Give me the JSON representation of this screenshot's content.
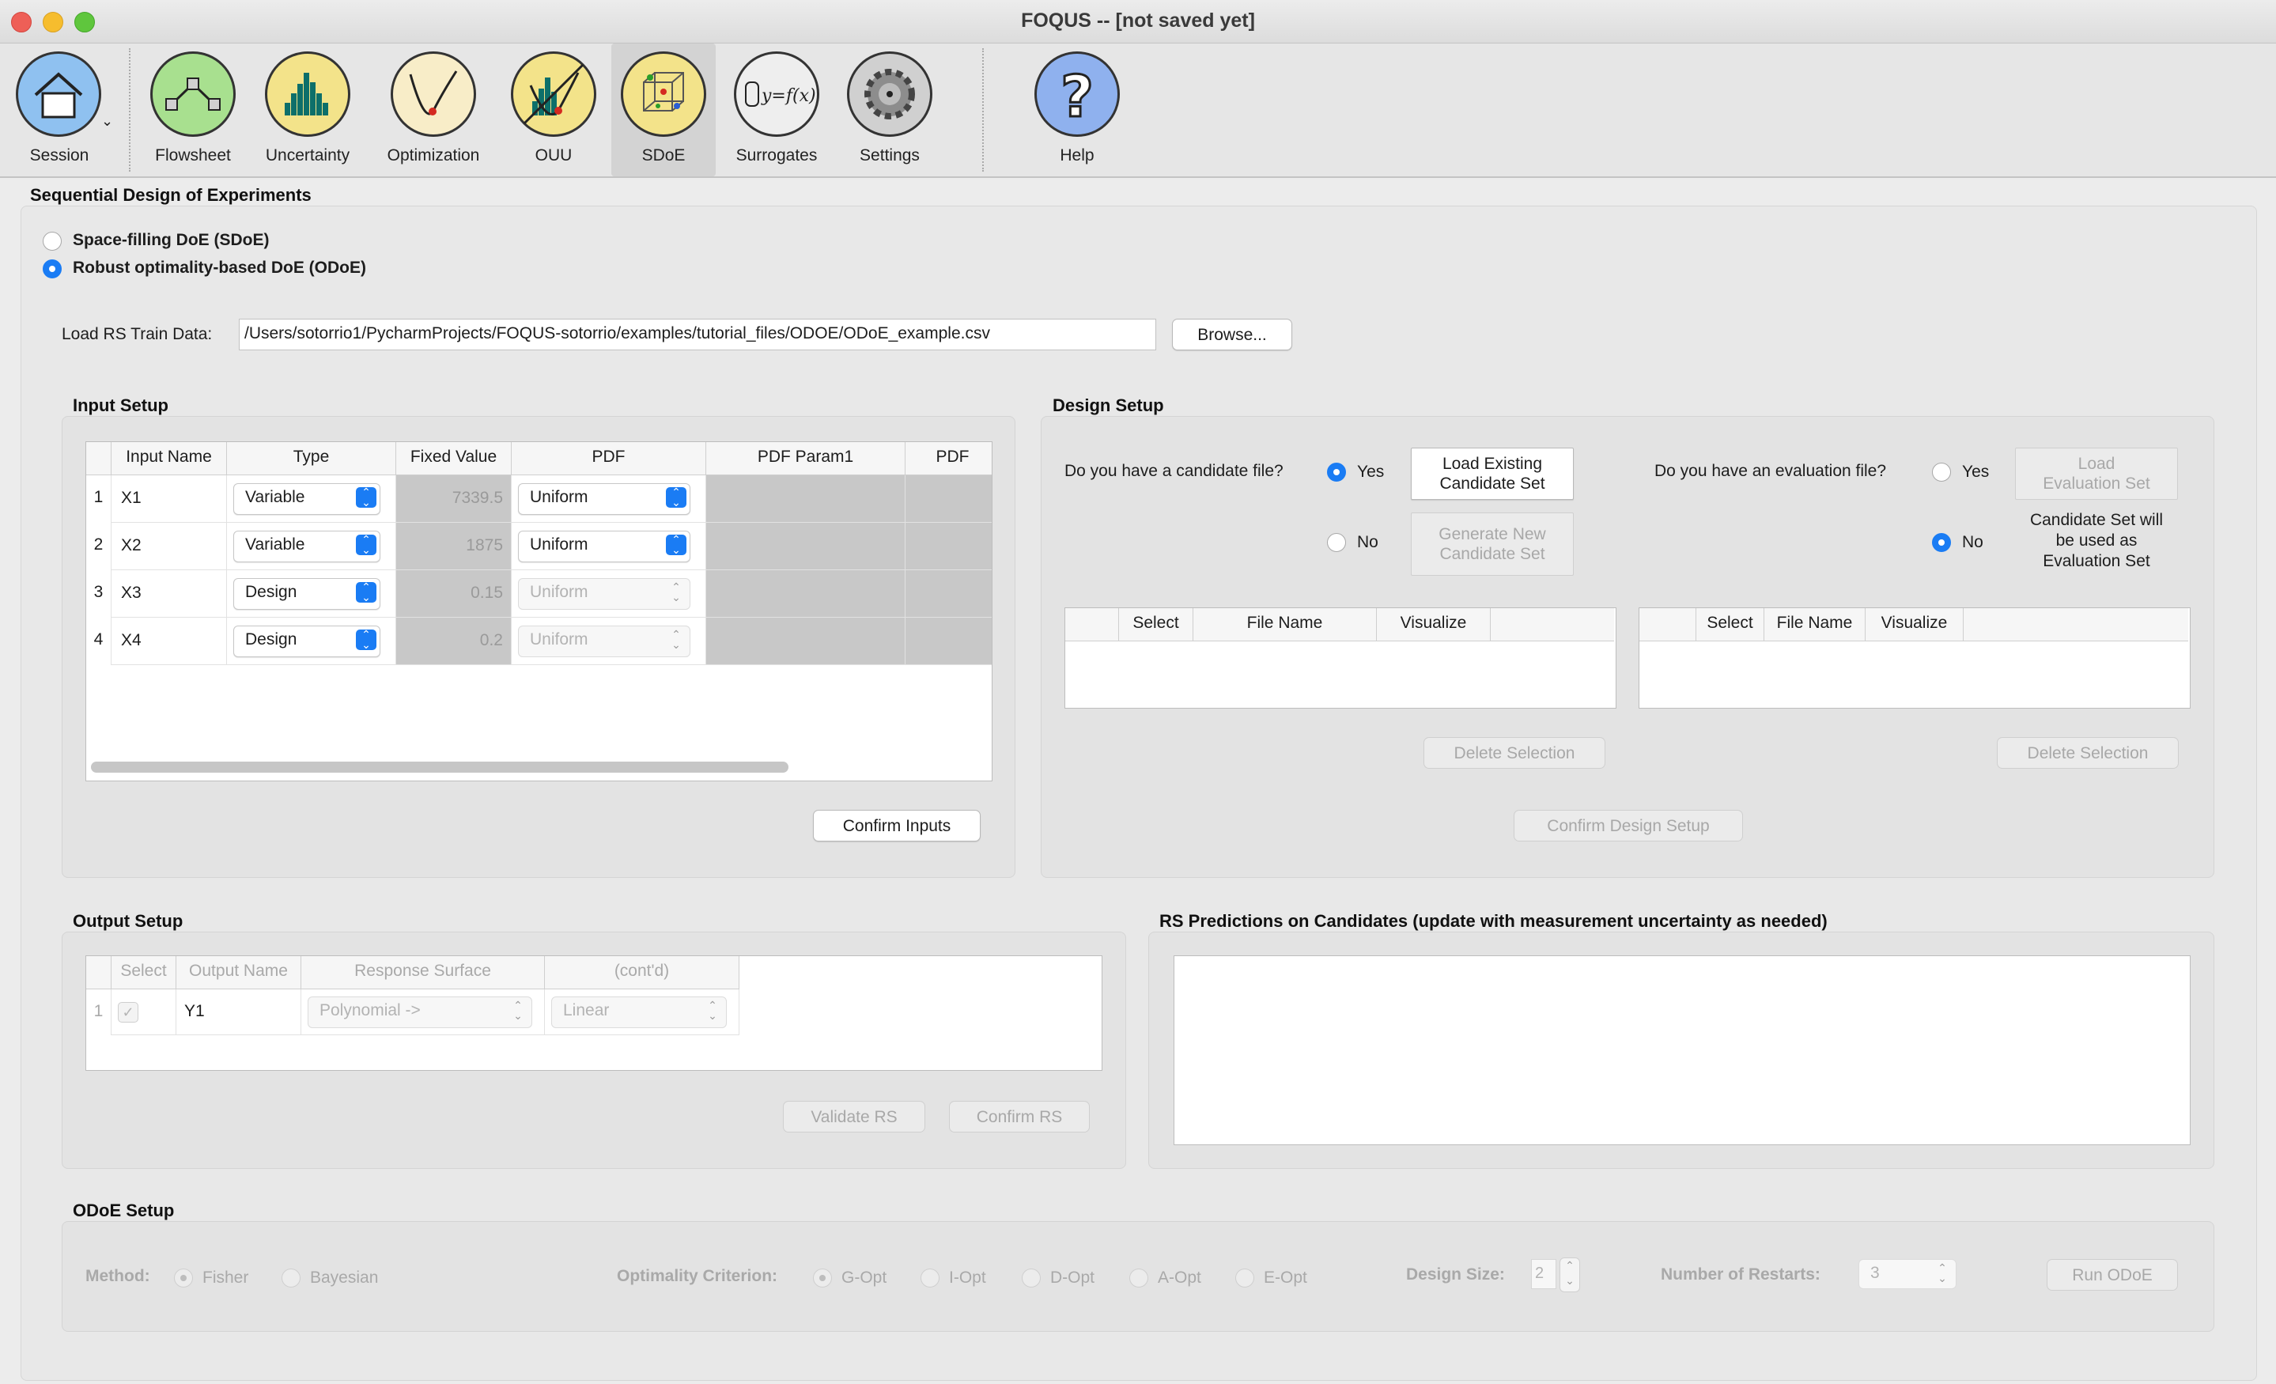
{
  "window": {
    "title": "FOQUS -- [not saved yet]"
  },
  "toolbar": {
    "items": [
      {
        "label": "Session",
        "icon": "house-icon"
      },
      {
        "label": "Flowsheet",
        "icon": "flowsheet-icon"
      },
      {
        "label": "Uncertainty",
        "icon": "histogram-icon"
      },
      {
        "label": "Optimization",
        "icon": "optimization-curve-icon"
      },
      {
        "label": "OUU",
        "icon": "ouu-icon"
      },
      {
        "label": "SDoE",
        "icon": "sdoe-cube-icon"
      },
      {
        "label": "Surrogates",
        "icon": "surrogate-function-icon"
      },
      {
        "label": "Settings",
        "icon": "gear-icon"
      },
      {
        "label": "Help",
        "icon": "question-icon"
      }
    ],
    "active": "SDoE",
    "surrogate_glyph": "y=f(x)",
    "help_glyph": "?"
  },
  "page": {
    "title": "Sequential Design of Experiments",
    "mode_sdoe": "Space-filling DoE (SDoE)",
    "mode_odoe": "Robust optimality-based DoE (ODoE)",
    "load_label": "Load RS Train Data:",
    "load_path": "/Users/sotorrio1/PycharmProjects/FOQUS-sotorrio/examples/tutorial_files/ODOE/ODoE_example.csv",
    "browse": "Browse..."
  },
  "input_setup": {
    "title": "Input Setup",
    "columns": [
      "Input Name",
      "Type",
      "Fixed Value",
      "PDF",
      "PDF Param1",
      "PDF"
    ],
    "rows": [
      {
        "num": "1",
        "name": "X1",
        "type": "Variable",
        "fixed": "7339.5",
        "pdf": "Uniform"
      },
      {
        "num": "2",
        "name": "X2",
        "type": "Variable",
        "fixed": "1875",
        "pdf": "Uniform"
      },
      {
        "num": "3",
        "name": "X3",
        "type": "Design",
        "fixed": "0.15",
        "pdf": "Uniform"
      },
      {
        "num": "4",
        "name": "X4",
        "type": "Design",
        "fixed": "0.2",
        "pdf": "Uniform"
      }
    ],
    "confirm": "Confirm Inputs"
  },
  "design_setup": {
    "title": "Design Setup",
    "candidate_q": "Do you have a candidate file?",
    "eval_q": "Do you have an evaluation file?",
    "yes": "Yes",
    "no": "No",
    "load_candidate": [
      "Load Existing",
      "Candidate Set"
    ],
    "generate_candidate": [
      "Generate New",
      "Candidate Set"
    ],
    "load_eval": [
      "Load",
      "Evaluation Set"
    ],
    "eval_note": [
      "Candidate Set will",
      "be used as",
      "Evaluation Set"
    ],
    "cand_columns": [
      "Select",
      "File Name",
      "Visualize"
    ],
    "eval_columns": [
      "Select",
      "File Name",
      "Visualize"
    ],
    "delete": "Delete Selection",
    "confirm": "Confirm Design Setup"
  },
  "output_setup": {
    "title": "Output Setup",
    "columns": [
      "Select",
      "Output Name",
      "Response Surface",
      "(cont'd)"
    ],
    "row": {
      "num": "1",
      "name": "Y1",
      "rs": "Polynomial ->",
      "cont": "Linear"
    },
    "validate": "Validate RS",
    "confirm": "Confirm RS"
  },
  "rs_predictions": {
    "title": "RS Predictions on Candidates (update with measurement uncertainty as needed)"
  },
  "odoe_setup": {
    "title": "ODoE Setup",
    "method_label": "Method:",
    "methods": [
      "Fisher",
      "Bayesian"
    ],
    "criterion_label": "Optimality Criterion:",
    "criteria": [
      "G-Opt",
      "I-Opt",
      "D-Opt",
      "A-Opt",
      "E-Opt"
    ],
    "design_size_label": "Design Size:",
    "design_size": "2",
    "restarts_label": "Number of Restarts:",
    "restarts": "3",
    "run": "Run ODoE"
  }
}
